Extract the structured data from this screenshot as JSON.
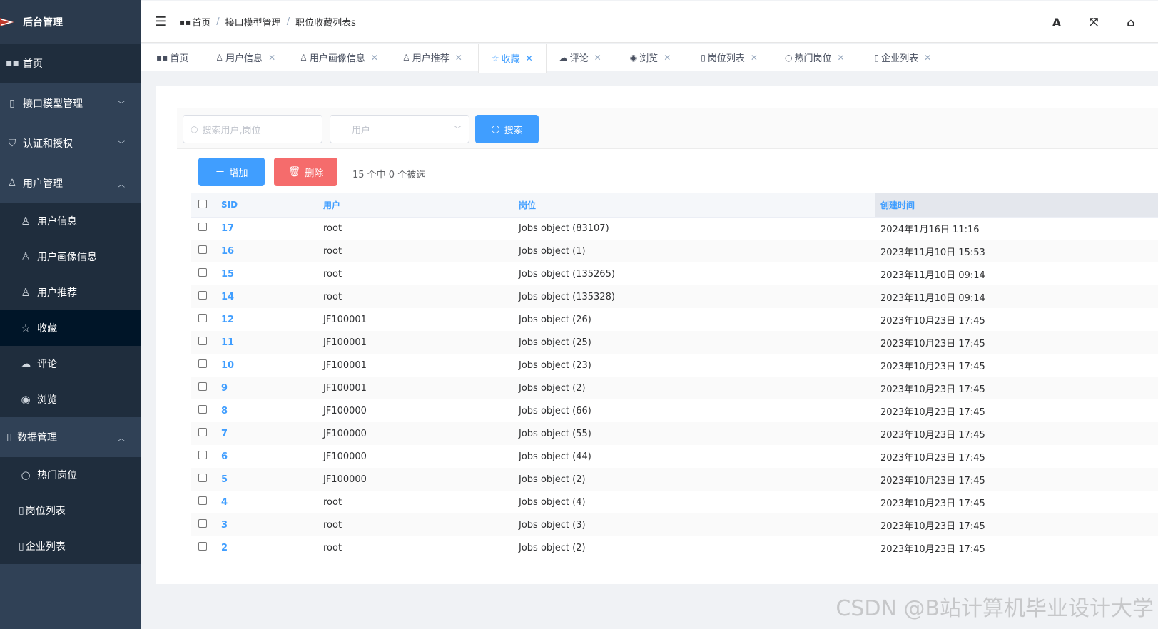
{
  "sidebar": {
    "title": "后台管理",
    "home": "首页",
    "groups": [
      {
        "label": "接口模型管理",
        "icon": "document-icon"
      },
      {
        "label": "认证和授权",
        "icon": "shield-icon"
      },
      {
        "label": "用户管理",
        "icon": "user-icon"
      }
    ],
    "user_items": [
      "用户信息",
      "用户画像信息",
      "用户推荐",
      "收藏",
      "评论",
      "浏览"
    ],
    "data_group": "数据管理",
    "data_items": [
      "热门岗位",
      "岗位列表",
      "企业列表"
    ]
  },
  "navbar": {
    "breadcrumbs": [
      "首页",
      "接口模型管理",
      "职位收藏列表s"
    ],
    "right_icons": [
      "font-size-icon",
      "fullscreen-icon",
      "home-icon"
    ],
    "font_icon_glyph": "A"
  },
  "tags": [
    "首页",
    "用户信息",
    "用户画像信息",
    "用户推荐",
    "收藏",
    "评论",
    "浏览",
    "岗位列表",
    "热门岗位",
    "企业列表"
  ],
  "toolbar": {
    "search_placeholder": "搜索用户,岗位",
    "select_placeholder": "用户",
    "search_label": "搜索",
    "add_label": "增加",
    "delete_label": "删除",
    "selection_info": "15 个中 0 个被选"
  },
  "table": {
    "columns": [
      "SID",
      "用户",
      "岗位",
      "创建时间"
    ],
    "rows": [
      {
        "sid": "17",
        "user": "root",
        "job": "Jobs object (83107)",
        "time": "2024年1月16日 11:16"
      },
      {
        "sid": "16",
        "user": "root",
        "job": "Jobs object (1)",
        "time": "2023年11月10日 15:53"
      },
      {
        "sid": "15",
        "user": "root",
        "job": "Jobs object (135265)",
        "time": "2023年11月10日 09:14"
      },
      {
        "sid": "14",
        "user": "root",
        "job": "Jobs object (135328)",
        "time": "2023年11月10日 09:14"
      },
      {
        "sid": "12",
        "user": "JF100001",
        "job": "Jobs object (26)",
        "time": "2023年10月23日 17:45"
      },
      {
        "sid": "11",
        "user": "JF100001",
        "job": "Jobs object (25)",
        "time": "2023年10月23日 17:45"
      },
      {
        "sid": "10",
        "user": "JF100001",
        "job": "Jobs object (23)",
        "time": "2023年10月23日 17:45"
      },
      {
        "sid": "9",
        "user": "JF100001",
        "job": "Jobs object (2)",
        "time": "2023年10月23日 17:45"
      },
      {
        "sid": "8",
        "user": "JF100000",
        "job": "Jobs object (66)",
        "time": "2023年10月23日 17:45"
      },
      {
        "sid": "7",
        "user": "JF100000",
        "job": "Jobs object (55)",
        "time": "2023年10月23日 17:45"
      },
      {
        "sid": "6",
        "user": "JF100000",
        "job": "Jobs object (44)",
        "time": "2023年10月23日 17:45"
      },
      {
        "sid": "5",
        "user": "JF100000",
        "job": "Jobs object (2)",
        "time": "2023年10月23日 17:45"
      },
      {
        "sid": "4",
        "user": "root",
        "job": "Jobs object (4)",
        "time": "2023年10月23日 17:45"
      },
      {
        "sid": "3",
        "user": "root",
        "job": "Jobs object (3)",
        "time": "2023年10月23日 17:45"
      },
      {
        "sid": "2",
        "user": "root",
        "job": "Jobs object (2)",
        "time": "2023年10月23日 17:45"
      }
    ]
  },
  "watermark": "CSDN @B站计算机毕业设计大学",
  "colors": {
    "accent": "#409eff",
    "danger": "#f56c6c",
    "sidebar": "#304156"
  }
}
